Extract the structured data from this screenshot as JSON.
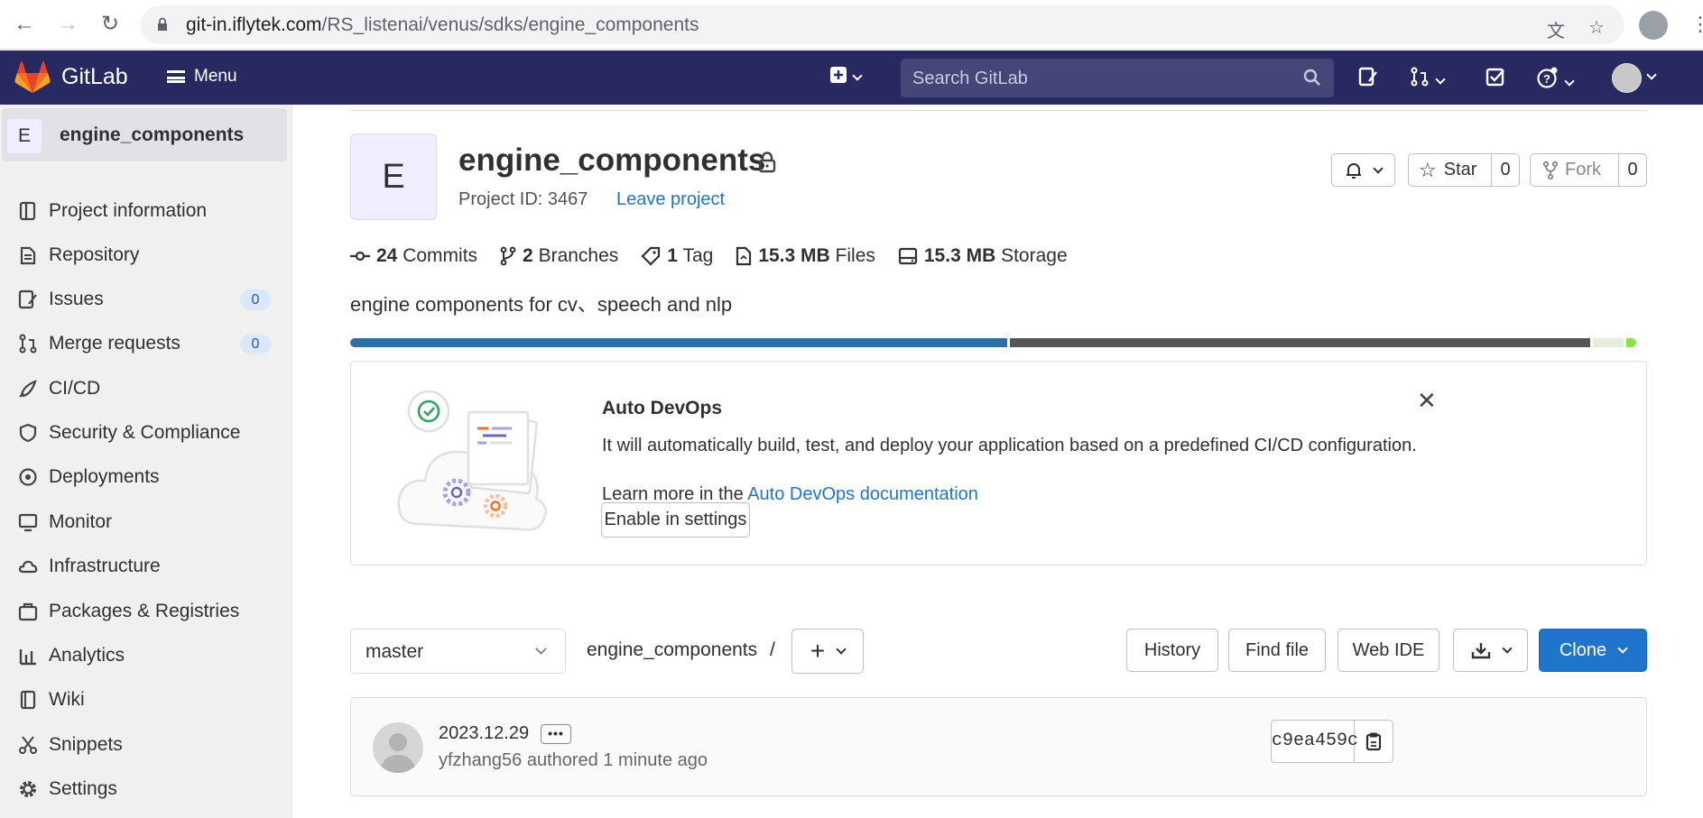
{
  "browser": {
    "url_host": "git-in.iflytek.com",
    "url_path": "/RS_listenai/venus/sdks/engine_components"
  },
  "header": {
    "brand": "GitLab",
    "menu_label": "Menu",
    "search_placeholder": "Search GitLab"
  },
  "sidebar": {
    "context_avatar": "E",
    "context_name": "engine_components",
    "items": [
      {
        "label": "Project information",
        "icon": "info-icon"
      },
      {
        "label": "Repository",
        "icon": "repository-icon"
      },
      {
        "label": "Issues",
        "icon": "issues-icon",
        "count": "0"
      },
      {
        "label": "Merge requests",
        "icon": "merge-request-icon",
        "count": "0"
      },
      {
        "label": "CI/CD",
        "icon": "rocket-icon"
      },
      {
        "label": "Security & Compliance",
        "icon": "shield-icon"
      },
      {
        "label": "Deployments",
        "icon": "deployments-icon"
      },
      {
        "label": "Monitor",
        "icon": "monitor-icon"
      },
      {
        "label": "Infrastructure",
        "icon": "cloud-icon"
      },
      {
        "label": "Packages & Registries",
        "icon": "package-icon"
      },
      {
        "label": "Analytics",
        "icon": "chart-icon"
      },
      {
        "label": "Wiki",
        "icon": "book-icon"
      },
      {
        "label": "Snippets",
        "icon": "scissors-icon"
      },
      {
        "label": "Settings",
        "icon": "gear-icon"
      }
    ]
  },
  "project": {
    "avatar": "E",
    "name": "engine_components",
    "project_id": "Project ID: 3467",
    "leave_label": "Leave project",
    "star_label": "Star",
    "star_count": "0",
    "fork_label": "Fork",
    "fork_count": "0",
    "description": "engine components for cv、speech and nlp",
    "stats": {
      "commits_num": "24",
      "commits_label": "Commits",
      "branches_num": "2",
      "branches_label": "Branches",
      "tags_num": "1",
      "tags_label": "Tag",
      "files_num": "15.3 MB",
      "files_label": "Files",
      "storage_num": "15.3 MB",
      "storage_label": "Storage"
    },
    "language_bar": [
      {
        "color": "#2f6fa6",
        "fraction": 0.51
      },
      {
        "color": "#555555",
        "fraction": 0.45
      },
      {
        "color": "#e3efdc",
        "fraction": 0.024
      },
      {
        "color": "#89e051",
        "fraction": 0.008
      }
    ]
  },
  "auto_devops": {
    "title": "Auto DevOps",
    "text": "It will automatically build, test, and deploy your application based on a predefined CI/CD configuration.",
    "learn_prefix": "Learn more in the",
    "learn_link": "Auto DevOps documentation",
    "enable_button": "Enable in settings"
  },
  "toolbar": {
    "branch": "master",
    "path": "engine_components",
    "path_sep": "/",
    "history": "History",
    "find_file": "Find file",
    "web_ide": "Web IDE",
    "clone": "Clone"
  },
  "commit": {
    "message": "2023.12.29",
    "author_line": "yfzhang56 authored 1 minute ago",
    "sha": "c9ea459c"
  }
}
